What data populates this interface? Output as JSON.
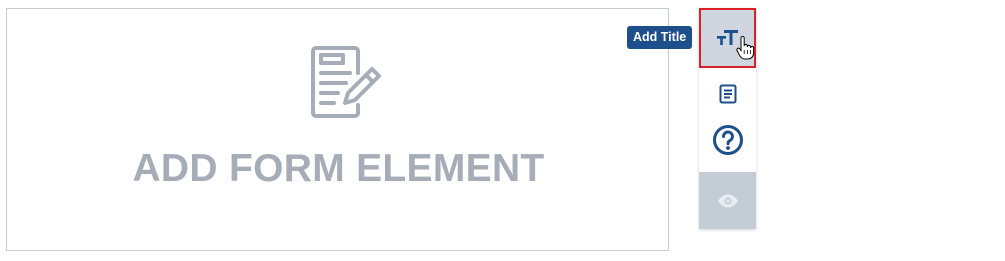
{
  "form_area": {
    "label": "ADD FORM ELEMENT",
    "icon": "form-edit-icon"
  },
  "tooltip": {
    "text": "Add Title"
  },
  "toolbar": {
    "items": [
      {
        "name": "add-title",
        "icon": "text-size-icon",
        "selected": true
      },
      {
        "name": "add-text",
        "icon": "document-icon"
      },
      {
        "name": "add-question",
        "icon": "question-circle-icon"
      },
      {
        "name": "preview",
        "icon": "eye-icon"
      }
    ]
  },
  "colors": {
    "accent": "#1d4f8c",
    "highlight_border": "#d92228",
    "placeholder_text": "#a7adb8",
    "selected_bg": "#cfd6e0",
    "preview_bg": "#c4ccd6"
  }
}
